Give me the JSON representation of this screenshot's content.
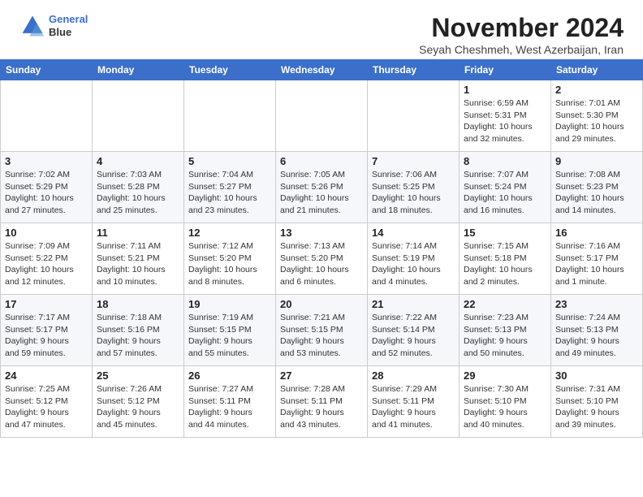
{
  "header": {
    "logo_line1": "General",
    "logo_line2": "Blue",
    "month_title": "November 2024",
    "subtitle": "Seyah Cheshmeh, West Azerbaijan, Iran"
  },
  "weekdays": [
    "Sunday",
    "Monday",
    "Tuesday",
    "Wednesday",
    "Thursday",
    "Friday",
    "Saturday"
  ],
  "weeks": [
    [
      {
        "day": "",
        "info": ""
      },
      {
        "day": "",
        "info": ""
      },
      {
        "day": "",
        "info": ""
      },
      {
        "day": "",
        "info": ""
      },
      {
        "day": "",
        "info": ""
      },
      {
        "day": "1",
        "info": "Sunrise: 6:59 AM\nSunset: 5:31 PM\nDaylight: 10 hours\nand 32 minutes."
      },
      {
        "day": "2",
        "info": "Sunrise: 7:01 AM\nSunset: 5:30 PM\nDaylight: 10 hours\nand 29 minutes."
      }
    ],
    [
      {
        "day": "3",
        "info": "Sunrise: 7:02 AM\nSunset: 5:29 PM\nDaylight: 10 hours\nand 27 minutes."
      },
      {
        "day": "4",
        "info": "Sunrise: 7:03 AM\nSunset: 5:28 PM\nDaylight: 10 hours\nand 25 minutes."
      },
      {
        "day": "5",
        "info": "Sunrise: 7:04 AM\nSunset: 5:27 PM\nDaylight: 10 hours\nand 23 minutes."
      },
      {
        "day": "6",
        "info": "Sunrise: 7:05 AM\nSunset: 5:26 PM\nDaylight: 10 hours\nand 21 minutes."
      },
      {
        "day": "7",
        "info": "Sunrise: 7:06 AM\nSunset: 5:25 PM\nDaylight: 10 hours\nand 18 minutes."
      },
      {
        "day": "8",
        "info": "Sunrise: 7:07 AM\nSunset: 5:24 PM\nDaylight: 10 hours\nand 16 minutes."
      },
      {
        "day": "9",
        "info": "Sunrise: 7:08 AM\nSunset: 5:23 PM\nDaylight: 10 hours\nand 14 minutes."
      }
    ],
    [
      {
        "day": "10",
        "info": "Sunrise: 7:09 AM\nSunset: 5:22 PM\nDaylight: 10 hours\nand 12 minutes."
      },
      {
        "day": "11",
        "info": "Sunrise: 7:11 AM\nSunset: 5:21 PM\nDaylight: 10 hours\nand 10 minutes."
      },
      {
        "day": "12",
        "info": "Sunrise: 7:12 AM\nSunset: 5:20 PM\nDaylight: 10 hours\nand 8 minutes."
      },
      {
        "day": "13",
        "info": "Sunrise: 7:13 AM\nSunset: 5:20 PM\nDaylight: 10 hours\nand 6 minutes."
      },
      {
        "day": "14",
        "info": "Sunrise: 7:14 AM\nSunset: 5:19 PM\nDaylight: 10 hours\nand 4 minutes."
      },
      {
        "day": "15",
        "info": "Sunrise: 7:15 AM\nSunset: 5:18 PM\nDaylight: 10 hours\nand 2 minutes."
      },
      {
        "day": "16",
        "info": "Sunrise: 7:16 AM\nSunset: 5:17 PM\nDaylight: 10 hours\nand 1 minute."
      }
    ],
    [
      {
        "day": "17",
        "info": "Sunrise: 7:17 AM\nSunset: 5:17 PM\nDaylight: 9 hours\nand 59 minutes."
      },
      {
        "day": "18",
        "info": "Sunrise: 7:18 AM\nSunset: 5:16 PM\nDaylight: 9 hours\nand 57 minutes."
      },
      {
        "day": "19",
        "info": "Sunrise: 7:19 AM\nSunset: 5:15 PM\nDaylight: 9 hours\nand 55 minutes."
      },
      {
        "day": "20",
        "info": "Sunrise: 7:21 AM\nSunset: 5:15 PM\nDaylight: 9 hours\nand 53 minutes."
      },
      {
        "day": "21",
        "info": "Sunrise: 7:22 AM\nSunset: 5:14 PM\nDaylight: 9 hours\nand 52 minutes."
      },
      {
        "day": "22",
        "info": "Sunrise: 7:23 AM\nSunset: 5:13 PM\nDaylight: 9 hours\nand 50 minutes."
      },
      {
        "day": "23",
        "info": "Sunrise: 7:24 AM\nSunset: 5:13 PM\nDaylight: 9 hours\nand 49 minutes."
      }
    ],
    [
      {
        "day": "24",
        "info": "Sunrise: 7:25 AM\nSunset: 5:12 PM\nDaylight: 9 hours\nand 47 minutes."
      },
      {
        "day": "25",
        "info": "Sunrise: 7:26 AM\nSunset: 5:12 PM\nDaylight: 9 hours\nand 45 minutes."
      },
      {
        "day": "26",
        "info": "Sunrise: 7:27 AM\nSunset: 5:11 PM\nDaylight: 9 hours\nand 44 minutes."
      },
      {
        "day": "27",
        "info": "Sunrise: 7:28 AM\nSunset: 5:11 PM\nDaylight: 9 hours\nand 43 minutes."
      },
      {
        "day": "28",
        "info": "Sunrise: 7:29 AM\nSunset: 5:11 PM\nDaylight: 9 hours\nand 41 minutes."
      },
      {
        "day": "29",
        "info": "Sunrise: 7:30 AM\nSunset: 5:10 PM\nDaylight: 9 hours\nand 40 minutes."
      },
      {
        "day": "30",
        "info": "Sunrise: 7:31 AM\nSunset: 5:10 PM\nDaylight: 9 hours\nand 39 minutes."
      }
    ]
  ]
}
